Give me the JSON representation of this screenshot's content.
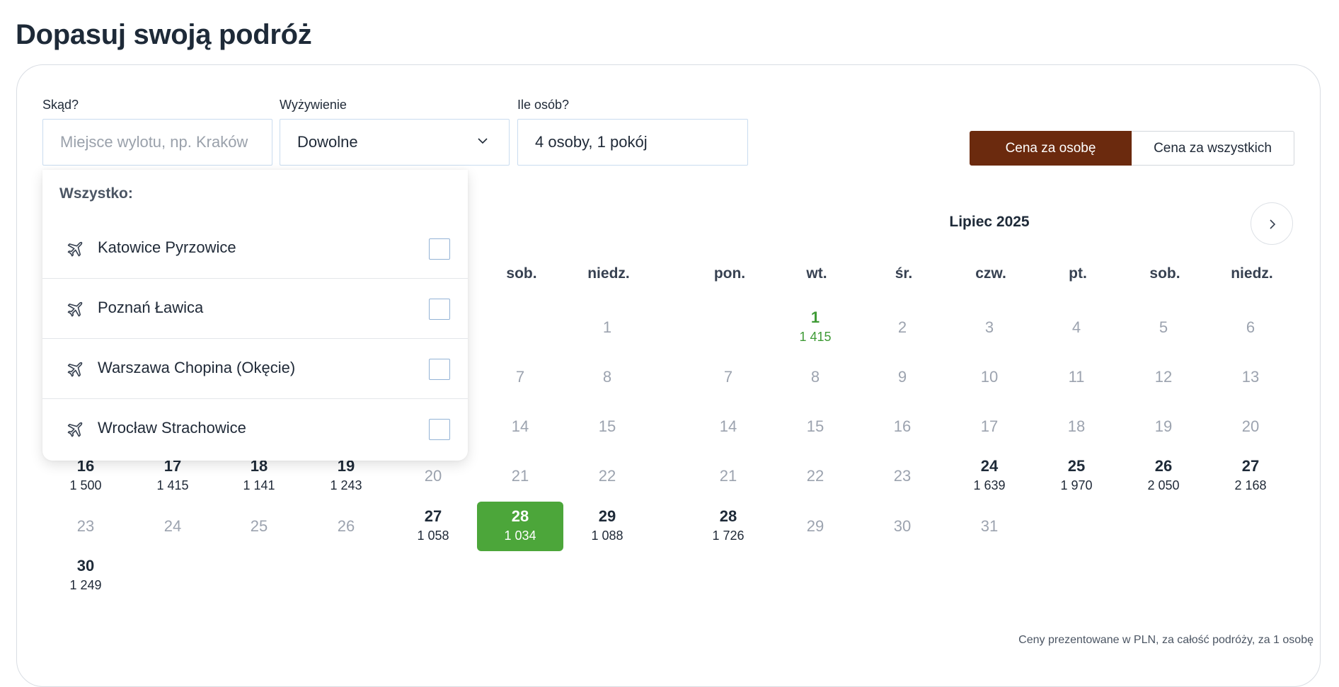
{
  "page_title": "Dopasuj swoją podróż",
  "filters": {
    "from": {
      "label": "Skąd?",
      "placeholder": "Miejsce wylotu, np. Kraków",
      "value": ""
    },
    "meal": {
      "label": "Wyżywienie",
      "value": "Dowolne"
    },
    "people": {
      "label": "Ile osób?",
      "value": "4 osoby, 1 pokój"
    }
  },
  "price_toggle": {
    "per_person": "Cena za osobę",
    "total": "Cena za wszystkich",
    "active": "per_person"
  },
  "dropdown": {
    "header": "Wszystko:",
    "items": [
      {
        "label": "Katowice Pyrzowice",
        "icon": "plane-icon",
        "checked": false
      },
      {
        "label": "Poznań Ławica",
        "icon": "plane-icon",
        "checked": false
      },
      {
        "label": "Warszawa Chopina (Okęcie)",
        "icon": "plane-icon",
        "checked": false
      },
      {
        "label": "Wrocław Strachowice",
        "icon": "plane-icon",
        "checked": false
      }
    ]
  },
  "calendar": {
    "month_title": "Lipiec 2025",
    "next_icon": "chevron-right-icon",
    "left_month": {
      "weekdays_visible": [
        "sob.",
        "niedz."
      ],
      "days": [
        {
          "num": "1"
        },
        {
          "num": "7"
        },
        {
          "num": "8"
        },
        {
          "num": "14"
        },
        {
          "num": "15"
        },
        {
          "num": "16",
          "price": "1 500"
        },
        {
          "num": "17",
          "price": "1 415"
        },
        {
          "num": "18",
          "price": "1 141"
        },
        {
          "num": "19",
          "price": "1 243"
        },
        {
          "num": "20"
        },
        {
          "num": "21"
        },
        {
          "num": "22"
        },
        {
          "num": "23"
        },
        {
          "num": "24"
        },
        {
          "num": "25"
        },
        {
          "num": "26"
        },
        {
          "num": "27",
          "price": "1 058"
        },
        {
          "num": "28",
          "price": "1 034",
          "selected": true
        },
        {
          "num": "29",
          "price": "1 088"
        },
        {
          "num": "30",
          "price": "1 249"
        }
      ]
    },
    "right_month": {
      "weekdays": [
        "pon.",
        "wt.",
        "śr.",
        "czw.",
        "pt.",
        "sob.",
        "niedz."
      ],
      "days": [
        {
          "num": "1",
          "price": "1 415",
          "highlight": true
        },
        {
          "num": "2"
        },
        {
          "num": "3"
        },
        {
          "num": "4"
        },
        {
          "num": "5"
        },
        {
          "num": "6"
        },
        {
          "num": "7"
        },
        {
          "num": "8"
        },
        {
          "num": "9"
        },
        {
          "num": "10"
        },
        {
          "num": "11"
        },
        {
          "num": "12"
        },
        {
          "num": "13"
        },
        {
          "num": "14"
        },
        {
          "num": "15"
        },
        {
          "num": "16"
        },
        {
          "num": "17"
        },
        {
          "num": "18"
        },
        {
          "num": "19"
        },
        {
          "num": "20"
        },
        {
          "num": "21"
        },
        {
          "num": "22"
        },
        {
          "num": "23"
        },
        {
          "num": "24",
          "price": "1 639"
        },
        {
          "num": "25",
          "price": "1 970"
        },
        {
          "num": "26",
          "price": "2 050"
        },
        {
          "num": "27",
          "price": "2 168"
        },
        {
          "num": "28",
          "price": "1 726"
        },
        {
          "num": "29"
        },
        {
          "num": "30"
        },
        {
          "num": "31"
        }
      ]
    }
  },
  "footnote": "Ceny prezentowane w PLN, za całość podróży, za 1 osobę",
  "colors": {
    "brand": "#6b2a0e",
    "green": "#4ca63a",
    "price_green": "#3f9b36"
  }
}
